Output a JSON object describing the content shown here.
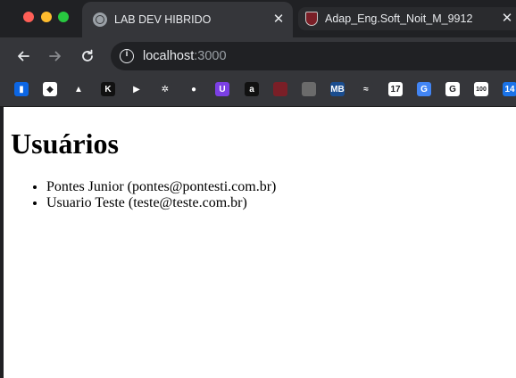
{
  "browser": {
    "tabs": [
      {
        "title": "LAB DEV HIBRIDO",
        "active": true,
        "favicon": "globe-icon"
      },
      {
        "title": "Adap_Eng.Soft_Noit_M_9912",
        "active": false,
        "favicon": "shield-icon"
      }
    ],
    "tab_close_glyph": "✕",
    "url_host": "localhost",
    "url_port": ":3000"
  },
  "bookmarks": [
    {
      "name": "trello-icon",
      "color": "#0c66e4",
      "glyph": "▮"
    },
    {
      "name": "clickup-icon",
      "color": "#ffffff",
      "glyph": "◆"
    },
    {
      "name": "atlassian-icon",
      "color": "#35363a",
      "glyph": "▲"
    },
    {
      "name": "k-icon",
      "color": "#111111",
      "glyph": "K"
    },
    {
      "name": "play-icon",
      "color": "#35363a",
      "glyph": "▶"
    },
    {
      "name": "chatgpt-icon",
      "color": "#35363a",
      "glyph": "✲"
    },
    {
      "name": "evernote-icon",
      "color": "#35363a",
      "glyph": "●"
    },
    {
      "name": "u-icon",
      "color": "#7b3fe4",
      "glyph": "U"
    },
    {
      "name": "a-icon",
      "color": "#111111",
      "glyph": "a"
    },
    {
      "name": "shield-icon",
      "color": "#7a1f27",
      "glyph": ""
    },
    {
      "name": "shield-icon-2",
      "color": "#6b6b6b",
      "glyph": ""
    },
    {
      "name": "mb-icon",
      "color": "#1a4d8f",
      "glyph": "MB"
    },
    {
      "name": "wave-icon",
      "color": "#35363a",
      "glyph": "≈"
    },
    {
      "name": "tradingview-icon",
      "color": "#ffffff",
      "glyph": "17"
    },
    {
      "name": "translate-icon",
      "color": "#4285f4",
      "glyph": "G"
    },
    {
      "name": "google-icon",
      "color": "#ffffff",
      "glyph": "G"
    },
    {
      "name": "100-icon",
      "color": "#ffffff",
      "glyph": "100"
    },
    {
      "name": "calendar-icon",
      "color": "#1a73e8",
      "glyph": "14"
    }
  ],
  "page": {
    "heading": "Usuários",
    "users": [
      "Pontes Junior (pontes@pontesti.com.br)",
      "Usuario Teste (teste@teste.com.br)"
    ]
  }
}
